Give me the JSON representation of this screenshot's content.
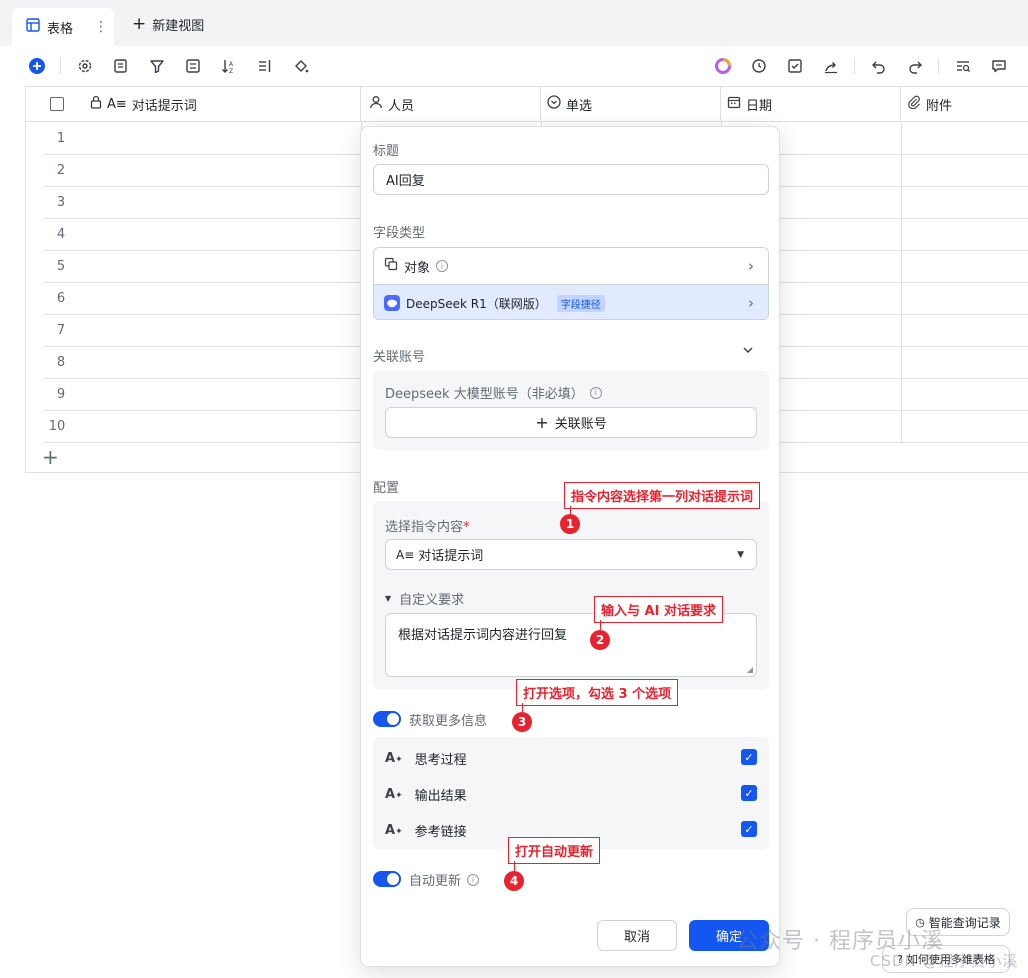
{
  "tabs": {
    "active_label": "表格",
    "new_view_label": "新建视图"
  },
  "grid": {
    "columns": [
      "对话提示词",
      "人员",
      "单选",
      "日期",
      "附件"
    ],
    "row_numbers": [
      "1",
      "2",
      "3",
      "4",
      "5",
      "6",
      "7",
      "8",
      "9",
      "10"
    ]
  },
  "panel": {
    "title_label": "标题",
    "title_value": "AI回复",
    "field_type_label": "字段类型",
    "type_object": "对象",
    "type_deepseek": "DeepSeek R1（联网版）",
    "type_deepseek_badge": "字段捷径",
    "linked_account_label": "关联账号",
    "account_hint": "Deepseek 大模型账号（非必填）",
    "link_account_button": "关联账号",
    "config_label": "配置",
    "instruction_label": "选择指令内容",
    "instruction_required": "*",
    "instruction_value": "对话提示词",
    "custom_req_label": "自定义要求",
    "custom_req_value": "根据对话提示词内容进行回复",
    "more_info_label": "获取更多信息",
    "options": [
      "思考过程",
      "输出结果",
      "参考链接"
    ],
    "auto_update_label": "自动更新",
    "cancel_button": "取消",
    "confirm_button": "确定"
  },
  "annotations": [
    {
      "num": "1",
      "text": "指令内容选择第一列对话提示词"
    },
    {
      "num": "2",
      "text": "输入与 AI 对话要求"
    },
    {
      "num": "3",
      "text": "打开选项，勾选 3 个选项"
    },
    {
      "num": "4",
      "text": "打开自动更新"
    }
  ],
  "side": {
    "smart_query": "智能查询记录",
    "how_to": "如何使用多维表格"
  },
  "watermark": {
    "line1": "公众号 · 程序员小溪",
    "line2": "CSDN @程序员小溪"
  },
  "colors": {
    "accent": "#1456f0",
    "annotation": "#e8222e",
    "border": "#dee0e3"
  }
}
